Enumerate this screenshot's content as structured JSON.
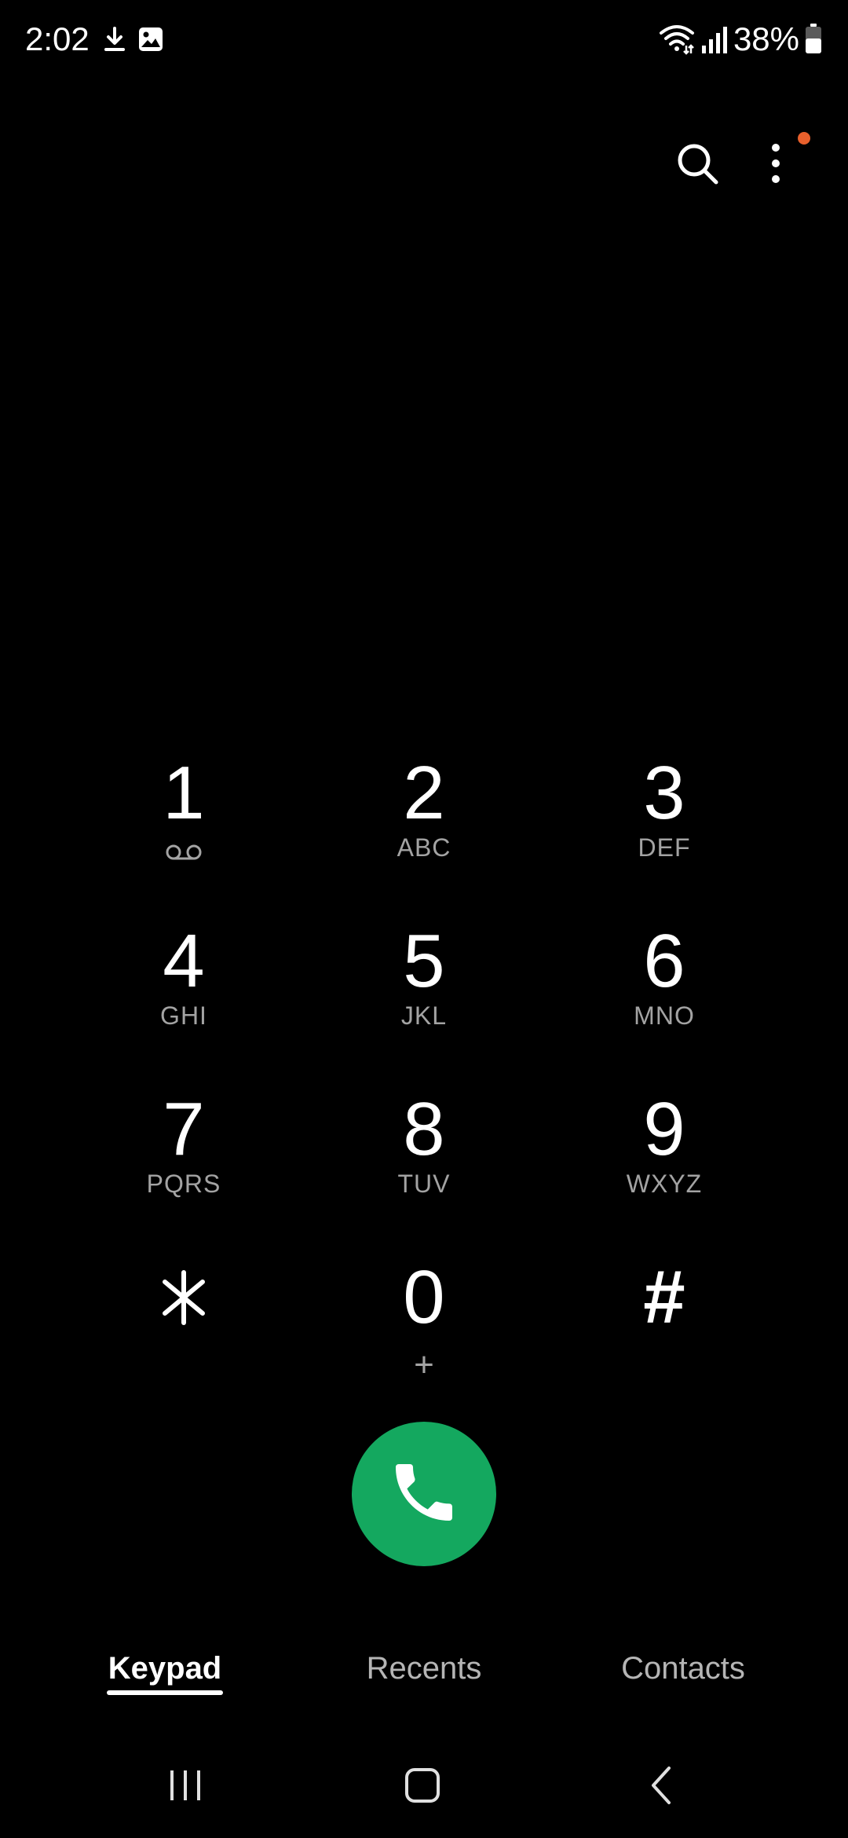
{
  "status_bar": {
    "time": "2:02",
    "battery": "38%",
    "icons": [
      "download-icon",
      "image-icon",
      "wifi-icon",
      "signal-icon",
      "battery-icon"
    ]
  },
  "top_actions": {
    "search_icon": "search-icon",
    "more_icon": "more-options-icon",
    "notification_dot_color": "#e8602c"
  },
  "keypad": {
    "rows": [
      [
        {
          "digit": "1",
          "letters": "",
          "sub_icon": "voicemail-icon"
        },
        {
          "digit": "2",
          "letters": "ABC"
        },
        {
          "digit": "3",
          "letters": "DEF"
        }
      ],
      [
        {
          "digit": "4",
          "letters": "GHI"
        },
        {
          "digit": "5",
          "letters": "JKL"
        },
        {
          "digit": "6",
          "letters": "MNO"
        }
      ],
      [
        {
          "digit": "7",
          "letters": "PQRS"
        },
        {
          "digit": "8",
          "letters": "TUV"
        },
        {
          "digit": "9",
          "letters": "WXYZ"
        }
      ],
      [
        {
          "digit": "*",
          "letters": ""
        },
        {
          "digit": "0",
          "letters": "+"
        },
        {
          "digit": "#",
          "letters": ""
        }
      ]
    ]
  },
  "call_button": {
    "icon": "phone-icon",
    "color": "#14a85f"
  },
  "tabs": [
    {
      "label": "Keypad",
      "active": true
    },
    {
      "label": "Recents",
      "active": false
    },
    {
      "label": "Contacts",
      "active": false
    }
  ],
  "system_nav": {
    "recents_icon": "recent-apps-icon",
    "home_icon": "home-icon",
    "back_icon": "back-icon"
  },
  "colors": {
    "background": "#000000",
    "text_primary": "#ffffff",
    "text_secondary": "#a3a3a3"
  }
}
